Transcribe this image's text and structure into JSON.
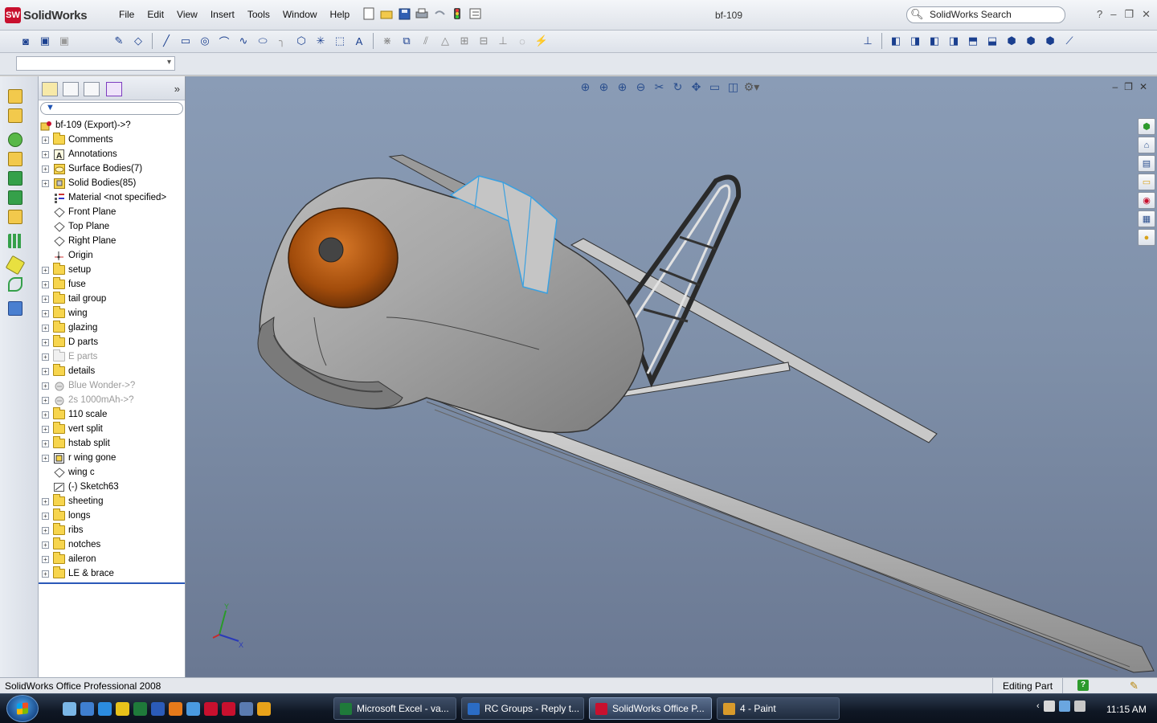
{
  "app": {
    "logo_text": "SolidWorks",
    "logo_badge": "SW",
    "doc_title": "bf-109",
    "search_placeholder": "SolidWorks Search",
    "help_label": "?"
  },
  "menu": [
    "File",
    "Edit",
    "View",
    "Insert",
    "Tools",
    "Window",
    "Help"
  ],
  "window_controls": [
    "–",
    "❐",
    "✕"
  ],
  "tree": {
    "expand_glyph": "»",
    "root": "bf-109  (Export)->?",
    "items": [
      {
        "label": "Comments",
        "icon": "comments-folder-icon",
        "expandable": true,
        "dim": false
      },
      {
        "label": "Annotations",
        "icon": "annotations-icon",
        "expandable": true,
        "dim": false
      },
      {
        "label": "Surface Bodies(7)",
        "icon": "surface-bodies-icon",
        "expandable": true,
        "dim": false
      },
      {
        "label": "Solid Bodies(85)",
        "icon": "solid-bodies-icon",
        "expandable": true,
        "dim": false
      },
      {
        "label": "Material <not specified>",
        "icon": "material-icon",
        "expandable": false,
        "dim": false
      },
      {
        "label": "Front Plane",
        "icon": "plane-icon",
        "expandable": false,
        "dim": false
      },
      {
        "label": "Top Plane",
        "icon": "plane-icon",
        "expandable": false,
        "dim": false
      },
      {
        "label": "Right Plane",
        "icon": "plane-icon",
        "expandable": false,
        "dim": false
      },
      {
        "label": "Origin",
        "icon": "origin-icon",
        "expandable": false,
        "dim": false
      },
      {
        "label": "setup",
        "icon": "folder-icon",
        "expandable": true,
        "dim": false
      },
      {
        "label": "fuse",
        "icon": "folder-icon",
        "expandable": true,
        "dim": false
      },
      {
        "label": "tail group",
        "icon": "folder-icon",
        "expandable": true,
        "dim": false
      },
      {
        "label": "wing",
        "icon": "folder-icon",
        "expandable": true,
        "dim": false
      },
      {
        "label": "glazing",
        "icon": "folder-icon",
        "expandable": true,
        "dim": false
      },
      {
        "label": "D parts",
        "icon": "folder-icon",
        "expandable": true,
        "dim": false
      },
      {
        "label": "E parts",
        "icon": "folder-icon",
        "expandable": true,
        "dim": true
      },
      {
        "label": "details",
        "icon": "folder-icon",
        "expandable": true,
        "dim": false
      },
      {
        "label": "Blue Wonder->?",
        "icon": "part-icon",
        "expandable": true,
        "dim": true
      },
      {
        "label": "2s 1000mAh->?",
        "icon": "part-icon",
        "expandable": true,
        "dim": true
      },
      {
        "label": "110 scale",
        "icon": "folder-icon",
        "expandable": true,
        "dim": false
      },
      {
        "label": "vert split",
        "icon": "folder-icon",
        "expandable": true,
        "dim": false
      },
      {
        "label": "hstab split",
        "icon": "folder-icon",
        "expandable": true,
        "dim": false
      },
      {
        "label": "r wing gone",
        "icon": "feature-icon",
        "expandable": true,
        "dim": false
      },
      {
        "label": "wing c",
        "icon": "plane-icon",
        "expandable": false,
        "dim": false
      },
      {
        "label": "(-) Sketch63",
        "icon": "sketch-icon",
        "expandable": false,
        "dim": false
      },
      {
        "label": "sheeting",
        "icon": "folder-icon",
        "expandable": true,
        "dim": false
      },
      {
        "label": "longs",
        "icon": "folder-icon",
        "expandable": true,
        "dim": false
      },
      {
        "label": "ribs",
        "icon": "folder-icon",
        "expandable": true,
        "dim": false
      },
      {
        "label": "notches",
        "icon": "folder-icon",
        "expandable": true,
        "dim": false
      },
      {
        "label": "aileron",
        "icon": "folder-icon",
        "expandable": true,
        "dim": false
      },
      {
        "label": "LE & brace",
        "icon": "folder-icon",
        "expandable": true,
        "dim": false
      }
    ]
  },
  "viewport": {
    "triad_y": "Y",
    "triad_x": "X",
    "controls": [
      "–",
      "❐",
      "✕"
    ]
  },
  "status": {
    "product": "SolidWorks Office Professional 2008",
    "mode": "Editing Part",
    "help": "?"
  },
  "taskbar": {
    "buttons": [
      {
        "label": "Microsoft Excel - va...",
        "icon_color": "#1f7a3a",
        "active": false
      },
      {
        "label": "RC Groups - Reply t...",
        "icon_color": "#2b6cc4",
        "active": false
      },
      {
        "label": "SolidWorks Office P...",
        "icon_color": "#c8102e",
        "active": true
      },
      {
        "label": "4 - Paint",
        "icon_color": "#d89a2b",
        "active": false
      }
    ],
    "clock": "11:15 AM"
  },
  "colors": {
    "viewport_top": "#8a9cb6",
    "viewport_bottom": "#6a7892",
    "spinner": "#b3560e",
    "canopy_edge": "#3aa0e0"
  }
}
